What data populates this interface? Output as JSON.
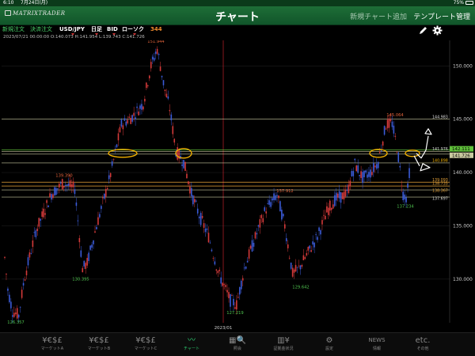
{
  "status_bar": {
    "time": "6:10",
    "date": "7月24日(月)",
    "battery": "75%"
  },
  "header": {
    "logo": "MATRIXTRADER",
    "title": "チャート",
    "add_chart": "新規チャート追加",
    "template": "テンプレート管理"
  },
  "toolbar": {
    "new_order": "新規注文",
    "settle_order": "決済注文",
    "pair": "USD/JPY",
    "period": "日足",
    "price_type": "BID",
    "chart_type": "ローソク",
    "count": "344"
  },
  "ohlc": "2023/07/21 00:00:00  O:140.073  H:141.954  L:139.743  C:141.726",
  "colors": {
    "up": "#d43a3a",
    "down": "#3b5bd8",
    "hline": "#c9c9a0",
    "orange_line": "#e6a33a",
    "green_line": "#5fbf3a",
    "annotation": "#f0b000",
    "high_label": "#e0623a",
    "low_label": "#4ec24e",
    "divider": "#c0202a"
  },
  "chart_data": {
    "type": "candlestick",
    "y_axis": [
      150.0,
      145.0,
      140.0,
      135.0,
      130.0
    ],
    "ylim": [
      125.9,
      152.4
    ],
    "x_label": "2023/01",
    "peak_labels": [
      {
        "value": "151.944",
        "kind": "high"
      },
      {
        "value": "145.064",
        "kind": "high"
      },
      {
        "value": "139.390",
        "kind": "high"
      },
      {
        "value": "137.912",
        "kind": "high"
      },
      {
        "value": "126.357",
        "kind": "low"
      },
      {
        "value": "130.395",
        "kind": "low"
      },
      {
        "value": "127.219",
        "kind": "low"
      },
      {
        "value": "129.642",
        "kind": "low"
      },
      {
        "value": "137.234",
        "kind": "low"
      }
    ],
    "level_labels": [
      "144.983",
      "141.976",
      "140.898",
      "139.093",
      "138.735",
      "138.367",
      "137.697"
    ],
    "price_tags": [
      "142.111",
      "141.726"
    ]
  },
  "tabs": [
    {
      "glyph": "¥€$£",
      "label": "マーケットA"
    },
    {
      "glyph": "¥€$£",
      "label": "マーケットB"
    },
    {
      "glyph": "¥€$£",
      "label": "マーケットC"
    },
    {
      "glyph": "〰",
      "label": "チャート"
    },
    {
      "glyph": "▦🔍",
      "label": "照会"
    },
    {
      "glyph": "▥¥",
      "label": "証拠金状況"
    },
    {
      "glyph": "⚙",
      "label": "設定"
    },
    {
      "glyph": "NEWS",
      "label": "情報"
    },
    {
      "glyph": "etc.",
      "label": "その他"
    }
  ]
}
